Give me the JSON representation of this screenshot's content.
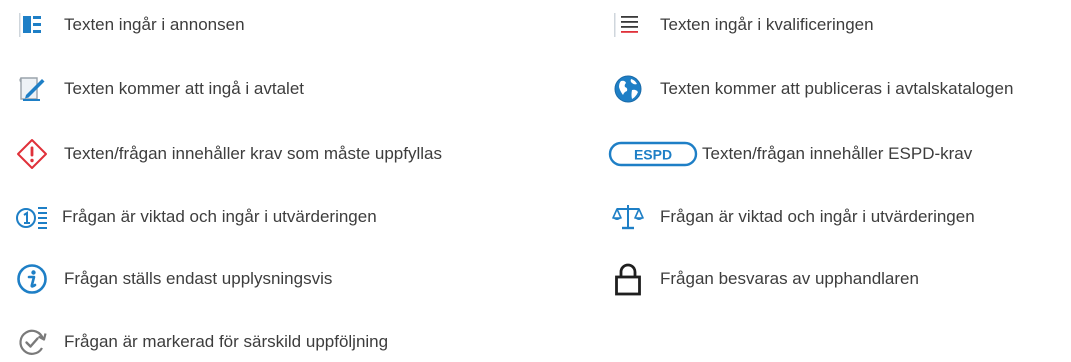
{
  "legend": {
    "left": [
      {
        "icon": "annons-icon",
        "label": "Texten ingår i annonsen"
      },
      {
        "icon": "contract-edit-icon",
        "label": "Texten kommer att ingå i avtalet"
      },
      {
        "icon": "requirement-warning-icon",
        "label": "Texten/frågan innehåller krav som måste uppfyllas"
      },
      {
        "icon": "weighted-number-icon",
        "label": "Frågan är viktad och ingår i utvärderingen"
      },
      {
        "icon": "info-icon",
        "label": "Frågan ställs endast upplysningsvis"
      },
      {
        "icon": "followup-check-icon",
        "label": "Frågan är markerad för särskild uppföljning"
      }
    ],
    "right": [
      {
        "icon": "qualification-lines-icon",
        "label": "Texten ingår i kvalificeringen"
      },
      {
        "icon": "globe-icon",
        "label": "Texten kommer att publiceras i avtalskatalogen"
      },
      {
        "icon": "espd-badge-icon",
        "badge_text": "ESPD",
        "label": "Texten/frågan innehåller ESPD-krav"
      },
      {
        "icon": "scale-icon",
        "label": "Frågan är viktad och ingår i utvärderingen"
      },
      {
        "icon": "lock-icon",
        "label": "Frågan besvaras av upphandlaren"
      }
    ]
  },
  "colors": {
    "blue": "#1e7fc6",
    "red": "#e0313a",
    "gray": "#7a7a7a",
    "text": "#3d3d3d"
  }
}
